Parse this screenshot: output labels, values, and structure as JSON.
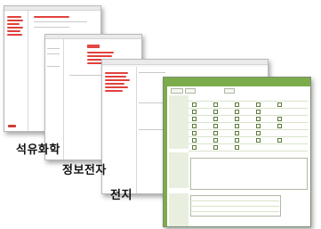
{
  "captions": {
    "petrochemical": "석유화학",
    "infoelectronics": "정보전자",
    "battery": "전지"
  },
  "colors": {
    "accent_red": "#e0413c",
    "frame_green": "#7cab4a",
    "window_gray": "#f6f6f6"
  }
}
